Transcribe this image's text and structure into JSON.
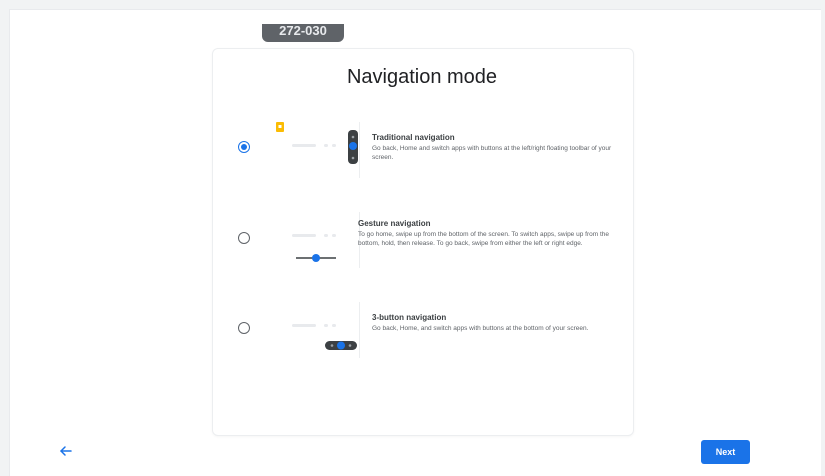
{
  "top_chip": {
    "text": "272-030"
  },
  "page": {
    "title": "Navigation mode"
  },
  "options": [
    {
      "title": "Traditional navigation",
      "description": "Go back, Home and switch apps with buttons at the left/right floating toolbar of your screen.",
      "selected": true
    },
    {
      "title": "Gesture navigation",
      "description": "To go home, swipe up from the bottom of the screen. To switch apps, swipe up from the bottom, hold, then release. To go back, swipe from either the left or right edge.",
      "selected": false
    },
    {
      "title": "3-button navigation",
      "description": "Go back, Home, and switch apps with buttons at the bottom of your screen.",
      "selected": false
    }
  ],
  "footer": {
    "next_label": "Next",
    "back_icon": "arrow-left-icon"
  },
  "colors": {
    "accent": "#1a73e8",
    "highlight": "#fbbc04",
    "text": "#202124"
  }
}
